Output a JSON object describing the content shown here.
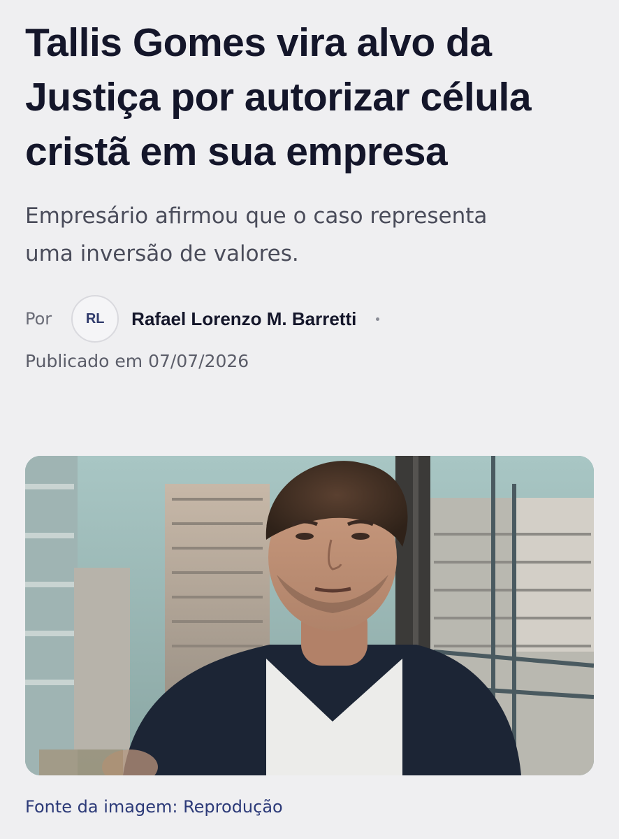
{
  "article": {
    "headline": "Tallis Gomes vira alvo da Justiça por autorizar célula cristã em sua empresa",
    "headline_lines": [
      "Tallis Gomes vira alvo da",
      "Justiça por autorizar célula",
      "cristã em sua empresa"
    ],
    "subtitle_lines": [
      "Empresário afirmou que o caso representa",
      "uma inversão de valores."
    ],
    "byline": {
      "prefix": "Por",
      "avatar_initials": "RL",
      "author": "Rafael Lorenzo M. Barretti"
    },
    "published": "Publicado em 07/07/2026",
    "image_caption": "Fonte da imagem: Reprodução"
  },
  "colors": {
    "background": "#efeff1",
    "headline": "#14162a",
    "caption_link": "#2c3a78"
  }
}
